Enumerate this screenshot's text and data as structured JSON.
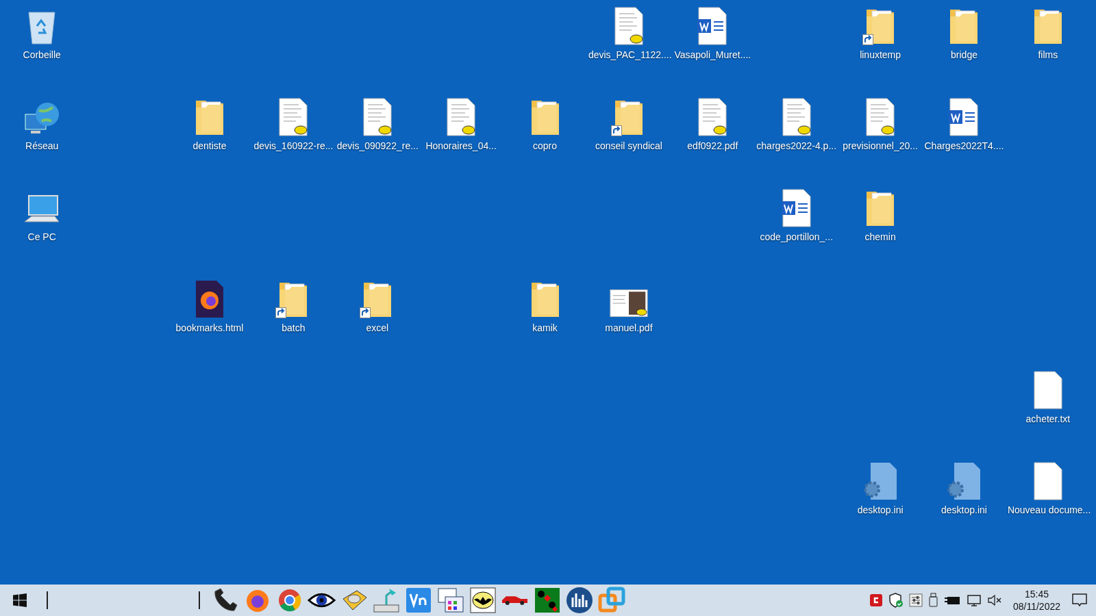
{
  "desktop": {
    "icons": [
      {
        "label": "Corbeille",
        "kind": "recycle-bin",
        "shortcut": false
      },
      {
        "label": "devis_PAC_1122....",
        "kind": "pdf",
        "shortcut": false
      },
      {
        "label": "Vasapoli_Muret....",
        "kind": "word",
        "shortcut": false
      },
      {
        "label": "linuxtemp",
        "kind": "folder",
        "shortcut": true
      },
      {
        "label": "bridge",
        "kind": "folder",
        "shortcut": false
      },
      {
        "label": "films",
        "kind": "folder",
        "shortcut": false
      },
      {
        "label": "Réseau",
        "kind": "network",
        "shortcut": false
      },
      {
        "label": "dentiste",
        "kind": "folder",
        "shortcut": false
      },
      {
        "label": "devis_160922-re...",
        "kind": "pdf",
        "shortcut": false
      },
      {
        "label": "devis_090922_re...",
        "kind": "pdf",
        "shortcut": false
      },
      {
        "label": "Honoraires_04...",
        "kind": "pdf",
        "shortcut": false
      },
      {
        "label": "copro",
        "kind": "folder",
        "shortcut": false
      },
      {
        "label": "conseil syndical",
        "kind": "folder",
        "shortcut": true
      },
      {
        "label": "edf0922.pdf",
        "kind": "pdf",
        "shortcut": false
      },
      {
        "label": "charges2022-4.p...",
        "kind": "pdf",
        "shortcut": false
      },
      {
        "label": "previsionnel_20...",
        "kind": "pdf",
        "shortcut": false
      },
      {
        "label": "Charges2022T4....",
        "kind": "word",
        "shortcut": false
      },
      {
        "label": "Ce PC",
        "kind": "computer",
        "shortcut": false
      },
      {
        "label": "code_portillon_...",
        "kind": "word",
        "shortcut": false
      },
      {
        "label": "chemin",
        "kind": "folder",
        "shortcut": false
      },
      {
        "label": "bookmarks.html",
        "kind": "html",
        "shortcut": false
      },
      {
        "label": "batch",
        "kind": "folder",
        "shortcut": true
      },
      {
        "label": "excel",
        "kind": "folder",
        "shortcut": true
      },
      {
        "label": "kamik",
        "kind": "folder",
        "shortcut": false
      },
      {
        "label": "manuel.pdf",
        "kind": "pdf-image",
        "shortcut": false
      },
      {
        "label": "acheter.txt",
        "kind": "text",
        "shortcut": false
      },
      {
        "label": "desktop.ini",
        "kind": "ini",
        "shortcut": false
      },
      {
        "label": "desktop.ini",
        "kind": "ini",
        "shortcut": false
      },
      {
        "label": "Nouveau docume...",
        "kind": "text",
        "shortcut": false
      }
    ]
  },
  "taskbar": {
    "pinned": [
      {
        "kind": "phone"
      },
      {
        "kind": "fox"
      },
      {
        "kind": "globe"
      },
      {
        "kind": "eye"
      },
      {
        "kind": "disc"
      },
      {
        "kind": "lamp"
      },
      {
        "kind": "remote"
      },
      {
        "kind": "windows"
      },
      {
        "kind": "bat"
      },
      {
        "kind": "car"
      },
      {
        "kind": "cards"
      },
      {
        "kind": "chart"
      },
      {
        "kind": "squares"
      }
    ],
    "tray": [
      {
        "kind": "red-app"
      },
      {
        "kind": "shield"
      },
      {
        "kind": "sliders"
      },
      {
        "kind": "usb"
      },
      {
        "kind": "battery"
      },
      {
        "kind": "monitor"
      },
      {
        "kind": "muted"
      }
    ],
    "time": "15:45",
    "date": "08/11/2022"
  }
}
